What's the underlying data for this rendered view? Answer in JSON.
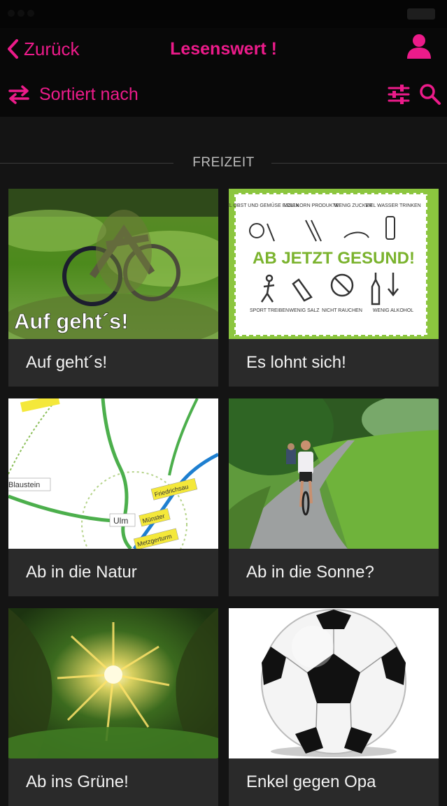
{
  "nav": {
    "back_label": "Zurück",
    "title": "Lesenswert !",
    "sort_label": "Sortiert nach"
  },
  "colors": {
    "accent": "#ec1b8a",
    "background": "#141414",
    "card": "#2a2a2a"
  },
  "section": {
    "label": "FREIZEIT"
  },
  "cards": [
    {
      "caption": "Auf geht´s!",
      "image_text": "Auf geht´s!",
      "icon": "moss-bicycle-photo"
    },
    {
      "caption": "Es lohnt sich!",
      "image_text": "AB JETZT GESUND!",
      "poster_top": [
        "VIEL OBST UND GEMÜSE ESSEN",
        "VOLLKORN PRODUKTE",
        "WENIG ZUCKER",
        "VIEL WASSER TRINKEN"
      ],
      "poster_bottom": [
        "SPORT TREIBEN",
        "WENIG SALZ",
        "NICHT RAUCHEN",
        "WENIG ALKOHOL"
      ],
      "icon": "healthy-living-poster"
    },
    {
      "caption": "Ab in die Natur",
      "map_labels": [
        "Blaustein",
        "Ulm",
        "Friedrichsau",
        "Münster",
        "Metzgerturm"
      ],
      "icon": "map-image"
    },
    {
      "caption": "Ab in die Sonne?",
      "icon": "cyclists-path-photo"
    },
    {
      "caption": "Ab ins Grüne!",
      "icon": "sun-through-trees-photo"
    },
    {
      "caption": "Enkel gegen Opa",
      "icon": "soccer-ball-photo"
    }
  ]
}
